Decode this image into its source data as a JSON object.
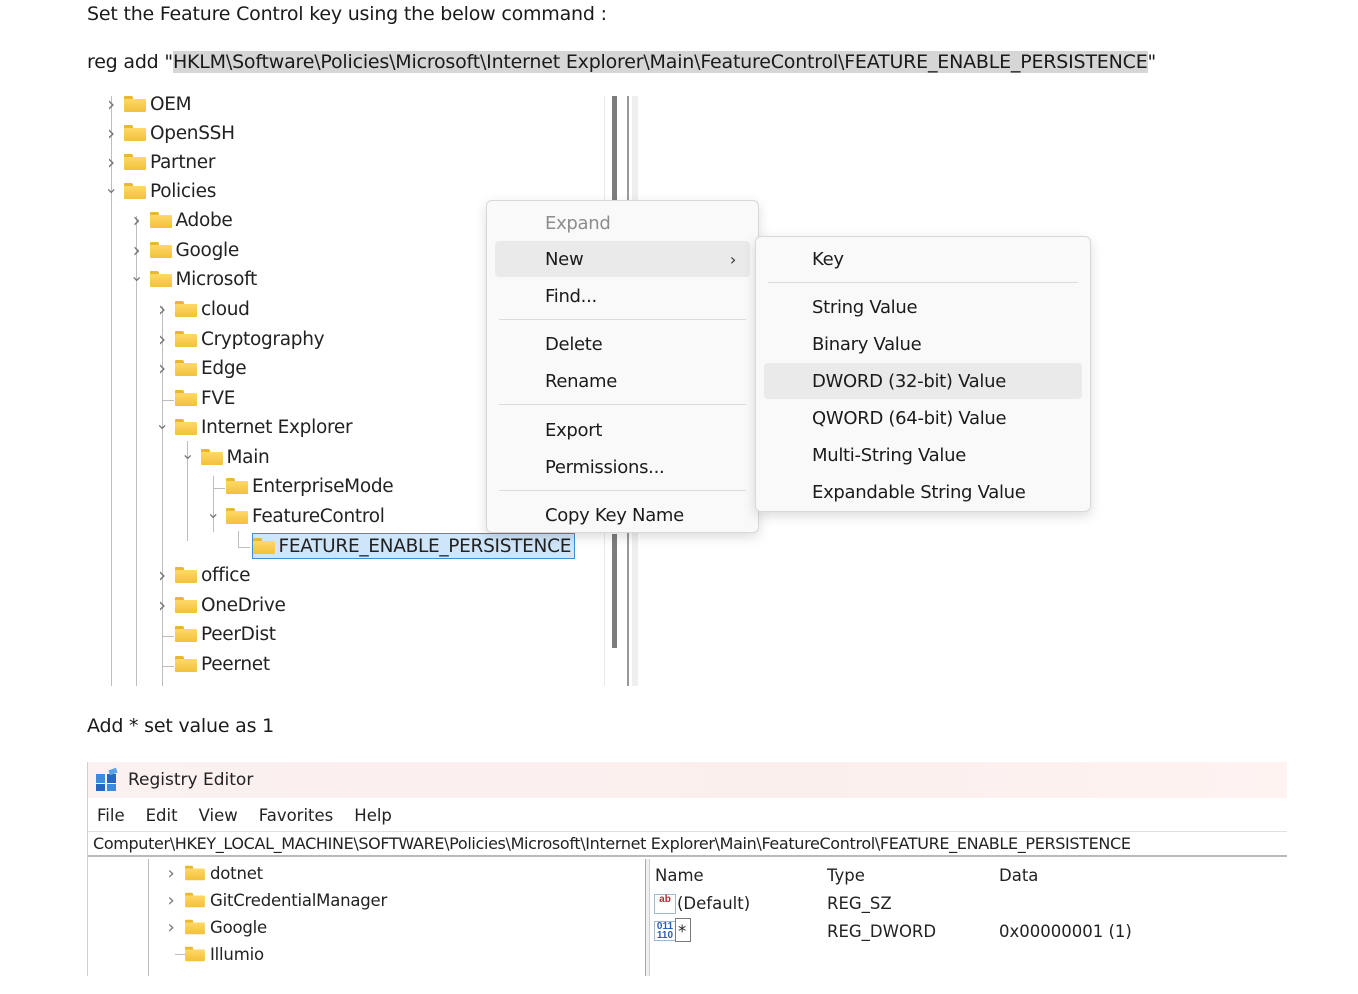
{
  "doc": {
    "line1": "Set the Feature Control key using the below command :",
    "cmd_prefix": "reg add \"",
    "cmd_path": "HKLM\\Software\\Policies\\Microsoft\\Internet Explorer\\Main\\FeatureControl\\FEATURE_ENABLE_PERSISTENCE",
    "cmd_suffix": "\"",
    "line3": "Add * set value as 1"
  },
  "tree1": {
    "items": [
      {
        "label": "OEM",
        "expanded": false
      },
      {
        "label": "OpenSSH",
        "expanded": false
      },
      {
        "label": "Partner",
        "expanded": false
      },
      {
        "label": "Policies",
        "expanded": true
      },
      {
        "label": "Adobe",
        "expanded": false
      },
      {
        "label": "Google",
        "expanded": false
      },
      {
        "label": "Microsoft",
        "expanded": true
      },
      {
        "label": "cloud",
        "expanded": false
      },
      {
        "label": "Cryptography",
        "expanded": false
      },
      {
        "label": "Edge",
        "expanded": false
      },
      {
        "label": "FVE",
        "expanded": null
      },
      {
        "label": "Internet Explorer",
        "expanded": true
      },
      {
        "label": "Main",
        "expanded": true
      },
      {
        "label": "EnterpriseMode",
        "expanded": null
      },
      {
        "label": "FeatureControl",
        "expanded": true
      },
      {
        "label": "FEATURE_ENABLE_PERSISTENCE",
        "expanded": null,
        "selected": true
      },
      {
        "label": "office",
        "expanded": false
      },
      {
        "label": "OneDrive",
        "expanded": false
      },
      {
        "label": "PeerDist",
        "expanded": null
      },
      {
        "label": "Peernet",
        "expanded": null
      }
    ]
  },
  "context_menu": {
    "expand": "Expand",
    "new": "New",
    "find": "Find...",
    "delete": "Delete",
    "rename": "Rename",
    "export": "Export",
    "permissions": "Permissions...",
    "copy_key_name": "Copy Key Name"
  },
  "submenu": {
    "key": "Key",
    "string_value": "String Value",
    "binary_value": "Binary Value",
    "dword_value": "DWORD (32-bit) Value",
    "qword_value": "QWORD (64-bit) Value",
    "multi_string_value": "Multi-String Value",
    "expandable_string_value": "Expandable String Value"
  },
  "regedit": {
    "title": "Registry Editor",
    "menu": [
      "File",
      "Edit",
      "View",
      "Favorites",
      "Help"
    ],
    "address": "Computer\\HKEY_LOCAL_MACHINE\\SOFTWARE\\Policies\\Microsoft\\Internet Explorer\\Main\\FeatureControl\\FEATURE_ENABLE_PERSISTENCE",
    "tree": [
      {
        "label": "dotnet",
        "expandable": true
      },
      {
        "label": "GitCredentialManager",
        "expandable": true
      },
      {
        "label": "Google",
        "expandable": true
      },
      {
        "label": "Illumio",
        "expandable": false
      }
    ],
    "columns": {
      "name": "Name",
      "type": "Type",
      "data": "Data"
    },
    "values": [
      {
        "name": "(Default)",
        "type": "REG_SZ",
        "data": ""
      },
      {
        "name": "*",
        "type": "REG_DWORD",
        "data": "0x00000001 (1)"
      }
    ]
  },
  "icons": {
    "folder": "folder-icon",
    "chevron_right": "chevron-right-icon",
    "chevron_down": "chevron-down-icon",
    "app": "registry-editor-icon",
    "string_value": "string-value-icon",
    "binary_value": "binary-value-icon"
  },
  "colors": {
    "folder": "#f2c13c",
    "selection": "#cfe5f9",
    "selection_border": "#3f8fd8",
    "highlight": "#d6d6d6",
    "titlebar": "#fbf0ef"
  }
}
